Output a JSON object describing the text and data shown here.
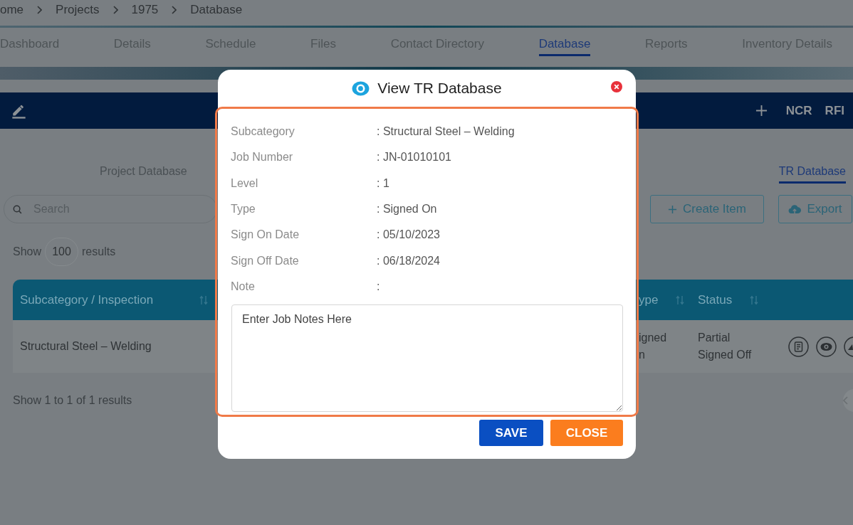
{
  "breadcrumb": [
    "ome",
    "Projects",
    "1975",
    "Database"
  ],
  "nav_tabs": [
    {
      "label": "Dashboard",
      "selected": false
    },
    {
      "label": "Details",
      "selected": false
    },
    {
      "label": "Schedule",
      "selected": false
    },
    {
      "label": "Files",
      "selected": false
    },
    {
      "label": "Contact Directory",
      "selected": false
    },
    {
      "label": "Database",
      "selected": true
    },
    {
      "label": "Reports",
      "selected": false
    },
    {
      "label": "Inventory Details",
      "selected": false
    }
  ],
  "toolbar": {
    "links": [
      "NCR",
      "RFI"
    ]
  },
  "sub_tabs": [
    {
      "label": "Project Database",
      "selected": false
    },
    {
      "label": "TR Database",
      "selected": true
    }
  ],
  "search": {
    "placeholder": "Search"
  },
  "actions": [
    {
      "label": "Create Item",
      "kind": "create"
    },
    {
      "label": "Export",
      "kind": "export"
    }
  ],
  "page_size": {
    "prefix": "Show",
    "value": "100",
    "suffix": "results"
  },
  "table": {
    "columns": [
      "Subcategory / Inspection",
      "ype",
      "Status"
    ],
    "rows": [
      {
        "cells": [
          "Structural Steel – Welding",
          "igned n",
          "Partial Signed Off"
        ]
      }
    ]
  },
  "footer": {
    "summary": "Show 1 to 1 of 1 results"
  },
  "modal": {
    "title": "View TR Database",
    "fields": [
      {
        "label": "Subcategory",
        "value": ": Structural Steel – Welding"
      },
      {
        "label": "Job Number",
        "value": ": JN-01010101"
      },
      {
        "label": "Level",
        "value": ": 1"
      },
      {
        "label": "Type",
        "value": ": Signed On"
      },
      {
        "label": "Sign On Date",
        "value": ": 05/10/2023"
      },
      {
        "label": "Sign Off Date",
        "value": ": 06/18/2024"
      },
      {
        "label": "Note",
        "value": ":"
      }
    ],
    "note": {
      "placeholder": "Enter Job Notes Here"
    },
    "buttons": [
      {
        "label": "SAVE",
        "kind": "primary"
      },
      {
        "label": "CLOSE",
        "kind": "secondary"
      }
    ]
  }
}
